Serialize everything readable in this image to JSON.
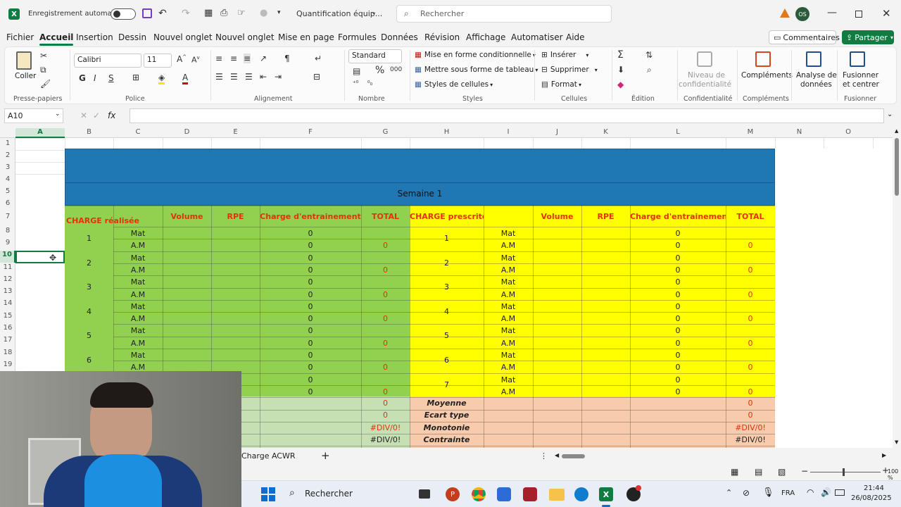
{
  "titlebar": {
    "autosave": "Enregistrement automatique",
    "doc_title": "Quantification équip...",
    "search_placeholder": "Rechercher",
    "user_initials": "OS"
  },
  "menu": [
    "Fichier",
    "Accueil",
    "Insertion",
    "Dessin",
    "Nouvel onglet",
    "Nouvel onglet",
    "Mise en page",
    "Formules",
    "Données",
    "Révision",
    "Affichage",
    "Automatiser",
    "Aide"
  ],
  "commentaires": "Commentaires",
  "partager": "Partager",
  "ribbon": {
    "clipboard": {
      "coller": "Coller",
      "label": "Presse-papiers"
    },
    "police": {
      "font": "Calibri",
      "size": "11",
      "label": "Police"
    },
    "alignement": {
      "label": "Alignement"
    },
    "nombre": {
      "format": "Standard",
      "label": "Nombre"
    },
    "styles": {
      "cond": "Mise en forme conditionnelle",
      "table": "Mettre sous forme de tableau",
      "cell": "Styles de cellules",
      "label": "Styles"
    },
    "cellules": {
      "insert": "Insérer",
      "delete": "Supprimer",
      "format": "Format",
      "label": "Cellules"
    },
    "edition": {
      "label": "Édition"
    },
    "conf": {
      "btn1": "Niveau de",
      "btn2": "confidentialité",
      "label": "Confidentialité"
    },
    "comp": {
      "btn": "Compléments",
      "label": "Compléments"
    },
    "analyse": {
      "btn1": "Analyse de",
      "btn2": "données"
    },
    "fusion": {
      "btn1": "Fusionner",
      "btn2": "et centrer",
      "label": "Fusionner"
    }
  },
  "namebox": "A10",
  "fx": "fx",
  "columns": [
    "A",
    "B",
    "C",
    "D",
    "E",
    "F",
    "G",
    "H",
    "I",
    "J",
    "K",
    "L",
    "M",
    "N",
    "O"
  ],
  "rows": [
    "1",
    "2",
    "3",
    "4",
    "5",
    "6",
    "7",
    "8",
    "9",
    "10",
    "11",
    "12",
    "13",
    "14",
    "15",
    "16",
    "17",
    "18",
    "19"
  ],
  "sheet": {
    "semaine": "Semaine 1",
    "left_headers": {
      "charge": "CHARGE réalisée",
      "volume": "Volume",
      "rpe": "RPE",
      "charge_ent": "Charge d'entrainement",
      "total": "TOTAL"
    },
    "right_headers": {
      "charge": "CHARGE prescrite",
      "volume": "Volume",
      "rpe": "RPE",
      "charge_ent": "Charge d'entrainement",
      "total": "TOTAL"
    },
    "mat": "Mat",
    "am": "A.M",
    "zero": "0",
    "days": [
      "1",
      "2",
      "3",
      "4",
      "5",
      "6",
      "7"
    ],
    "stats": [
      "Moyenne",
      "Ecart type",
      "Monotonie",
      "Contrainte"
    ],
    "stat_vals": [
      "0",
      "0",
      "#DIV/0!",
      "#DIV/0!"
    ]
  },
  "tabs": {
    "sheet": "Charge ACWR",
    "add": "+"
  },
  "zoom": "100 %",
  "taskbar": {
    "search": "Rechercher",
    "lang": "FRA",
    "time": "21:44",
    "date": "26/08/2025"
  }
}
